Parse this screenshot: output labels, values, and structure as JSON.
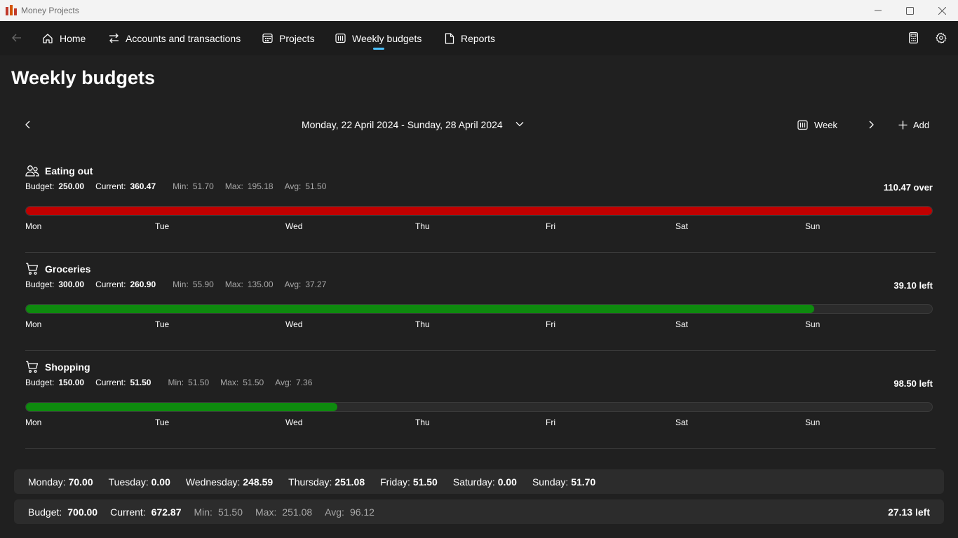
{
  "window": {
    "title": "Money Projects"
  },
  "nav": {
    "items": [
      {
        "label": "Home",
        "icon": "home-icon"
      },
      {
        "label": "Accounts and transactions",
        "icon": "transfer-icon"
      },
      {
        "label": "Projects",
        "icon": "calendar-grid-icon"
      },
      {
        "label": "Weekly budgets",
        "icon": "week-columns-icon",
        "selected": true
      },
      {
        "label": "Reports",
        "icon": "document-icon"
      }
    ],
    "right_icons": [
      "calculator-icon",
      "gear-icon"
    ],
    "accent_color": "#4cc2ff"
  },
  "page": {
    "title": "Weekly budgets"
  },
  "date_selector": {
    "range": "Monday, 22 April 2024 - Sunday, 28 April 2024",
    "view_label": "Week",
    "add_label": "Add"
  },
  "labels": {
    "budget": "Budget:",
    "current": "Current:",
    "min": "Min:",
    "max": "Max:",
    "avg": "Avg:"
  },
  "days_short": [
    "Mon",
    "Tue",
    "Wed",
    "Thu",
    "Fri",
    "Sat",
    "Sun"
  ],
  "budgets": [
    {
      "name": "Eating out",
      "icon": "people-icon",
      "budget": "250.00",
      "current": "360.47",
      "min": "51.70",
      "max": "195.18",
      "avg": "51.50",
      "status": "110.47 over",
      "progress": 1.0,
      "bar_color": "#c00000"
    },
    {
      "name": "Groceries",
      "icon": "cart-icon",
      "budget": "300.00",
      "current": "260.90",
      "min": "55.90",
      "max": "135.00",
      "avg": "37.27",
      "status": "39.10 left",
      "progress": 0.8697,
      "bar_color": "#0e8a0e"
    },
    {
      "name": "Shopping",
      "icon": "cart-icon",
      "budget": "150.00",
      "current": "51.50",
      "min": "51.50",
      "max": "51.50",
      "avg": "7.36",
      "status": "98.50 left",
      "progress": 0.3433,
      "bar_color": "#0e8a0e"
    }
  ],
  "daily_totals": [
    {
      "label": "Monday:",
      "value": "70.00"
    },
    {
      "label": "Tuesday:",
      "value": "0.00"
    },
    {
      "label": "Wednesday:",
      "value": "248.59"
    },
    {
      "label": "Thursday:",
      "value": "251.08"
    },
    {
      "label": "Friday:",
      "value": "51.50"
    },
    {
      "label": "Saturday:",
      "value": "0.00"
    },
    {
      "label": "Sunday:",
      "value": "51.70"
    }
  ],
  "total": {
    "budget": "700.00",
    "current": "672.87",
    "min": "51.50",
    "max": "251.08",
    "avg": "96.12",
    "status": "27.13 left"
  }
}
